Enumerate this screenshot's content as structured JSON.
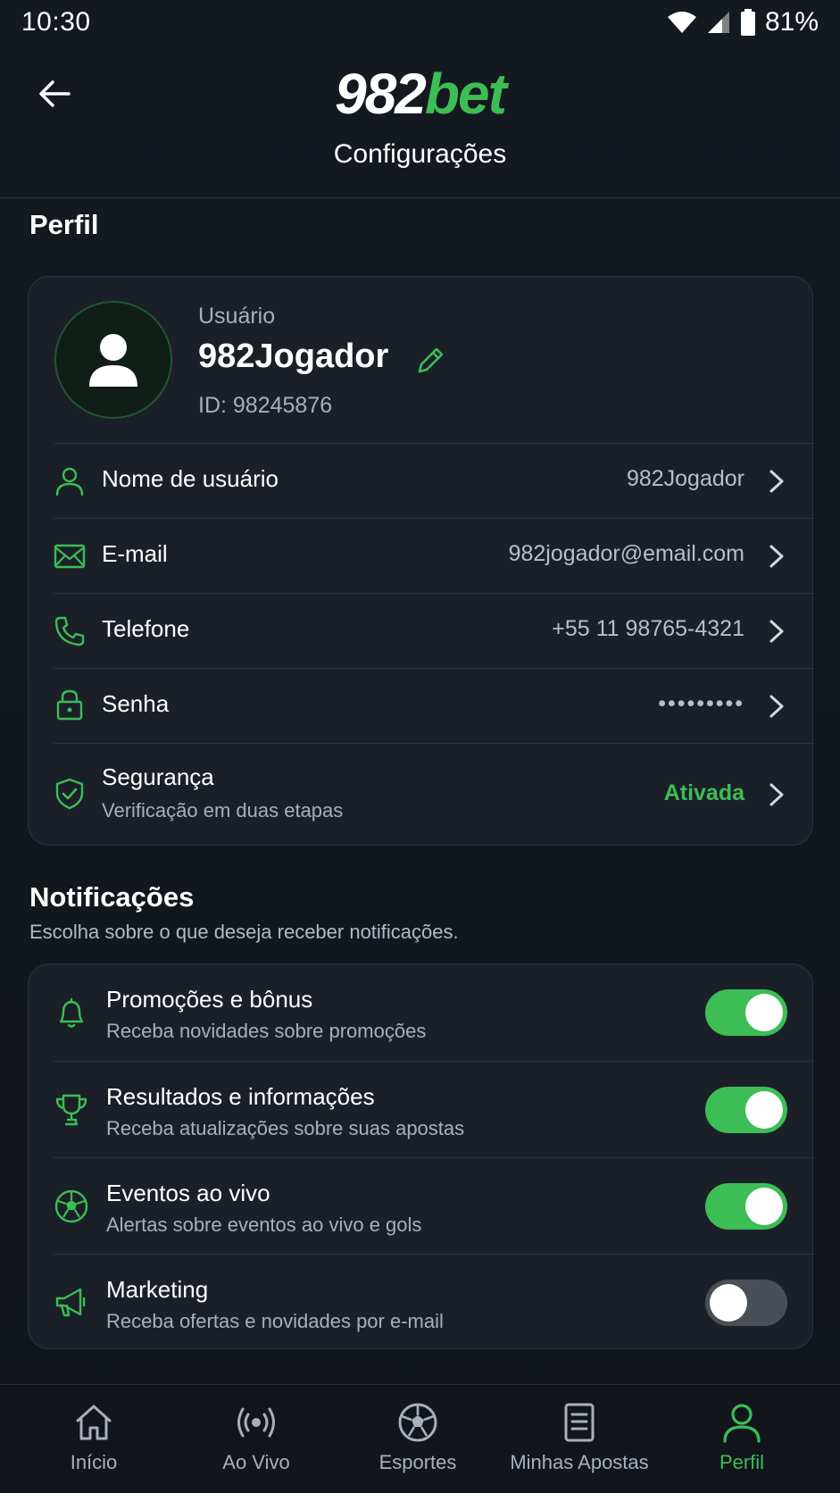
{
  "status_bar": {
    "time": "10:30",
    "battery": "81%"
  },
  "header": {
    "logo_primary": "982",
    "logo_accent": "bet",
    "title": "Configurações"
  },
  "profile": {
    "section_title": "Perfil",
    "user_label": "Usuário",
    "username": "982Jogador",
    "user_id": "ID: 98245876",
    "rows": [
      {
        "label": "Nome de usuário",
        "value": "982Jogador",
        "icon": "user-icon"
      },
      {
        "label": "E-mail",
        "value": "982jogador@email.com",
        "icon": "mail-icon"
      },
      {
        "label": "Telefone",
        "value": "+55 11 98765-4321",
        "icon": "phone-icon"
      },
      {
        "label": "Senha",
        "value": "•••••••••",
        "icon": "lock-icon"
      },
      {
        "label": "Segurança",
        "sublabel": "Verificação em duas etapas",
        "value": "Ativada",
        "icon": "shield-check-icon"
      }
    ]
  },
  "notifications": {
    "section_title": "Notificações",
    "subtitle": "Escolha sobre o que deseja receber notificações.",
    "items": [
      {
        "label": "Promoções e bônus",
        "sublabel": "Receba novidades sobre promoções",
        "enabled": true,
        "icon": "bell-icon"
      },
      {
        "label": "Resultados e informações",
        "sublabel": "Receba atualizações sobre suas apostas",
        "enabled": true,
        "icon": "trophy-icon"
      },
      {
        "label": "Eventos ao vivo",
        "sublabel": "Alertas sobre eventos ao vivo e gols",
        "enabled": true,
        "icon": "soccer-ball-icon"
      },
      {
        "label": "Marketing",
        "sublabel": "Receba ofertas e novidades por e-mail",
        "enabled": false,
        "icon": "megaphone-icon"
      }
    ]
  },
  "bottom_nav": [
    {
      "label": "Início",
      "icon": "home-icon",
      "active": false
    },
    {
      "label": "Ao Vivo",
      "icon": "live-broadcast-icon",
      "active": false
    },
    {
      "label": "Esportes",
      "icon": "soccer-ball-icon",
      "active": false
    },
    {
      "label": "Minhas Apostas",
      "icon": "bet-slip-icon",
      "active": false
    },
    {
      "label": "Perfil",
      "icon": "user-icon",
      "active": true
    }
  ],
  "colors": {
    "accent": "#3dbd55",
    "background": "#12161c",
    "card": "#1b2028"
  }
}
